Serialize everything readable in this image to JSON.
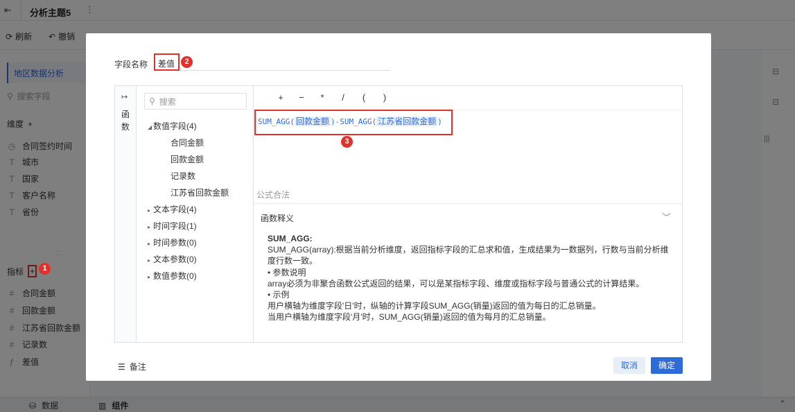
{
  "app": {
    "title": "分析主题5",
    "more": "⋮",
    "toolbar": {
      "refresh": "刷新",
      "undo": "撤销"
    },
    "data_tab": "地区数据分析",
    "search_placeholder": "搜索字段",
    "dimension_label": "维度",
    "dimensions": [
      {
        "icon": "time-icon",
        "label": "合同签约时间"
      },
      {
        "icon": "text-icon",
        "label": "城市"
      },
      {
        "icon": "text-icon",
        "label": "国家"
      },
      {
        "icon": "text-icon",
        "label": "客户名称"
      },
      {
        "icon": "text-icon",
        "label": "省份"
      }
    ],
    "measure_label": "指标",
    "measures": [
      {
        "icon": "number-icon",
        "label": "合同金额"
      },
      {
        "icon": "number-icon",
        "label": "回款金额"
      },
      {
        "icon": "number-icon",
        "label": "江苏省回款金额"
      },
      {
        "icon": "number-icon",
        "label": "记录数"
      },
      {
        "icon": "formula-icon",
        "label": "差值"
      }
    ],
    "bottom_tabs": {
      "data": "数据",
      "component": "组件"
    }
  },
  "dialog": {
    "field_name_label": "字段名称",
    "field_name_value": "差值",
    "rail_label": "函数",
    "tree_search_placeholder": "搜索",
    "tree": {
      "numeric_group": "数值字段(4)",
      "numeric_fields": [
        "合同金额",
        "回款金额",
        "记录数",
        "江苏省回款金额"
      ],
      "groups": [
        "文本字段(4)",
        "时间字段(1)",
        "时间参数(0)",
        "文本参数(0)",
        "数值参数(0)"
      ]
    },
    "operators": [
      "+",
      "−",
      "*",
      "/",
      "(",
      ")"
    ],
    "formula": {
      "fn1": "SUM_AGG(",
      "arg1": "回款金额",
      "mid": ")-SUM_AGG(",
      "arg2": "江苏省回款金额",
      "end": ")"
    },
    "formula_status": "公式合法",
    "doc_title": "函数释义",
    "doc": {
      "fn_name": "SUM_AGG:",
      "desc": "SUM_AGG(array):根据当前分析维度，返回指标字段的汇总求和值，生成结果为一数据列，行数与当前分析维度行数一致。",
      "param_head": "• 参数说明",
      "param_desc": "array必须为非聚合函数公式返回的结果，可以是某指标字段、维度或指标字段与普通公式的计算结果。",
      "example_head": "• 示例",
      "example1": "用户横轴为维度字段'日'时，纵轴的计算字段SUM_AGG(销量)返回的值为每日的汇总销量。",
      "example2": "当用户横轴为维度字段'月'时，SUM_AGG(销量)返回的值为每月的汇总销量。"
    },
    "note": "备注",
    "cancel": "取消",
    "ok": "确定"
  },
  "badges": {
    "b1": "1",
    "b2": "2",
    "b3": "3"
  }
}
